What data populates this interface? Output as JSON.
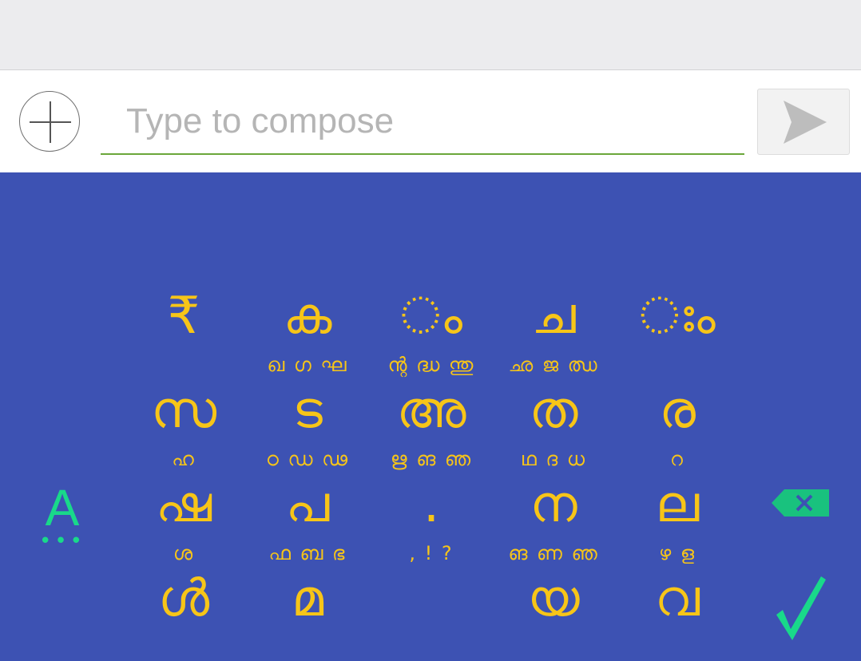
{
  "compose": {
    "placeholder": "Type to compose"
  },
  "colors": {
    "keyboard_bg": "#3d52b3",
    "key_text": "#f7c518",
    "accent_green": "#19d98a",
    "input_underline": "#6aa73a"
  },
  "keyboard": {
    "language_key": {
      "label": "A",
      "dots": "•••"
    },
    "rows": [
      [
        {
          "main": "₹",
          "alts": ""
        },
        {
          "main": "ക",
          "alts": "ഖ ഗ ഘ"
        },
        {
          "main": "ം",
          "alts": "ന്റ ദ്ധ ന്തു"
        },
        {
          "main": "ച",
          "alts": "ഛ ജ ഝ"
        },
        {
          "main": "ഃം",
          "alts": ""
        }
      ],
      [
        {
          "main": "സ",
          "alts": "ഹ"
        },
        {
          "main": "ട",
          "alts": "ഠ ഡ ഢ"
        },
        {
          "main": "അ",
          "alts": "ഋ ങ ഞ"
        },
        {
          "main": "ത",
          "alts": "ഥ ദ ധ"
        },
        {
          "main": "ര",
          "alts": "റ"
        }
      ],
      [
        {
          "main": "ഷ",
          "alts": "ശ"
        },
        {
          "main": "പ",
          "alts": "ഫ ബ ഭ"
        },
        {
          "main": ".",
          "alts": ", ! ?"
        },
        {
          "main": "ന",
          "alts": "ങ ണ ഞ"
        },
        {
          "main": "ല",
          "alts": "ഴ ള"
        }
      ],
      [
        {
          "main": "ൾ",
          "alts": ""
        },
        {
          "main": "മ",
          "alts": ""
        },
        {
          "main": "",
          "alts": ""
        },
        {
          "main": "യ",
          "alts": ""
        },
        {
          "main": "വ",
          "alts": ""
        }
      ]
    ],
    "backspace_icon": "backspace-icon",
    "enter_icon": "checkmark-icon"
  }
}
